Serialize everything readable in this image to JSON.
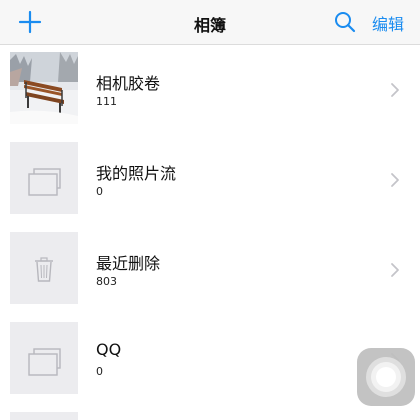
{
  "navbar": {
    "title": "相簿",
    "add_icon": "plus-icon",
    "search_icon": "search-icon",
    "edit_label": "编辑",
    "accent_color": "#1a8cf0"
  },
  "albums": [
    {
      "name": "相机胶卷",
      "count": "111",
      "thumbnail": "snowy-park-bench-photo"
    },
    {
      "name": "我的照片流",
      "count": "0",
      "thumbnail": "photo-stack-icon"
    },
    {
      "name": "最近删除",
      "count": "803",
      "thumbnail": "trash-icon"
    },
    {
      "name": "QQ",
      "count": "0",
      "thumbnail": "photo-stack-icon"
    }
  ],
  "assistive_touch": {
    "icon": "assistive-touch-icon"
  }
}
